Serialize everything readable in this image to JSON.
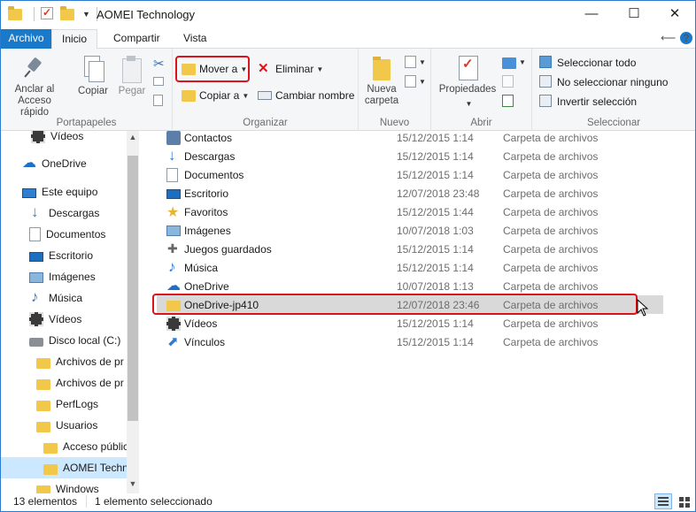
{
  "window": {
    "title": "AOMEI Technology",
    "minimize": "—",
    "maximize": "☐",
    "close": "✕"
  },
  "tabs": {
    "file": "Archivo",
    "home": "Inicio",
    "share": "Compartir",
    "view": "Vista",
    "help": "?"
  },
  "ribbon": {
    "clipboard": {
      "label": "Portapapeles",
      "pin": "Anclar al Acceso rápido",
      "copy": "Copiar",
      "paste": "Pegar"
    },
    "organize": {
      "label": "Organizar",
      "move_to": "Mover a",
      "copy_to": "Copiar a",
      "delete": "Eliminar",
      "rename": "Cambiar nombre"
    },
    "new": {
      "label": "Nuevo",
      "new_folder": "Nueva carpeta"
    },
    "open": {
      "label": "Abrir",
      "properties": "Propiedades"
    },
    "select": {
      "label": "Seleccionar",
      "select_all": "Seleccionar todo",
      "select_none": "No seleccionar ninguno",
      "invert": "Invertir selección"
    }
  },
  "nav": {
    "items": [
      {
        "label": "Vídeos",
        "icon": "video-icon"
      },
      {
        "label": "OneDrive",
        "icon": "onedrive-icon"
      },
      {
        "label": "Este equipo",
        "icon": "computer-icon"
      },
      {
        "label": "Descargas",
        "icon": "download-icon"
      },
      {
        "label": "Documentos",
        "icon": "documents-icon"
      },
      {
        "label": "Escritorio",
        "icon": "desktop-icon"
      },
      {
        "label": "Imágenes",
        "icon": "images-icon"
      },
      {
        "label": "Música",
        "icon": "music-icon"
      },
      {
        "label": "Vídeos",
        "icon": "video-icon"
      },
      {
        "label": "Disco local (C:)",
        "icon": "disk-icon"
      },
      {
        "label": "Archivos de pr",
        "icon": "folder-icon"
      },
      {
        "label": "Archivos de pr",
        "icon": "folder-icon"
      },
      {
        "label": "PerfLogs",
        "icon": "folder-icon"
      },
      {
        "label": "Usuarios",
        "icon": "folder-icon"
      },
      {
        "label": "Acceso públic",
        "icon": "folder-icon"
      },
      {
        "label": "AOMEI Techn",
        "icon": "folder-icon"
      },
      {
        "label": "Windows",
        "icon": "folder-icon"
      }
    ]
  },
  "files": [
    {
      "name": "Contactos",
      "date": "15/12/2015 1:14",
      "type": "Carpeta de archivos",
      "icon": "contacts-icon"
    },
    {
      "name": "Descargas",
      "date": "15/12/2015 1:14",
      "type": "Carpeta de archivos",
      "icon": "download-icon"
    },
    {
      "name": "Documentos",
      "date": "15/12/2015 1:14",
      "type": "Carpeta de archivos",
      "icon": "documents-icon"
    },
    {
      "name": "Escritorio",
      "date": "12/07/2018 23:48",
      "type": "Carpeta de archivos",
      "icon": "desktop-icon"
    },
    {
      "name": "Favoritos",
      "date": "15/12/2015 1:44",
      "type": "Carpeta de archivos",
      "icon": "star-icon"
    },
    {
      "name": "Imágenes",
      "date": "10/07/2018 1:03",
      "type": "Carpeta de archivos",
      "icon": "images-icon"
    },
    {
      "name": "Juegos guardados",
      "date": "15/12/2015 1:14",
      "type": "Carpeta de archivos",
      "icon": "games-icon"
    },
    {
      "name": "Música",
      "date": "15/12/2015 1:14",
      "type": "Carpeta de archivos",
      "icon": "music-icon"
    },
    {
      "name": "OneDrive",
      "date": "10/07/2018 1:13",
      "type": "Carpeta de archivos",
      "icon": "onedrive-icon"
    },
    {
      "name": "OneDrive-jp410",
      "date": "12/07/2018 23:46",
      "type": "Carpeta de archivos",
      "icon": "folder-icon"
    },
    {
      "name": "Vídeos",
      "date": "15/12/2015 1:14",
      "type": "Carpeta de archivos",
      "icon": "video-icon"
    },
    {
      "name": "Vínculos",
      "date": "15/12/2015 1:14",
      "type": "Carpeta de archivos",
      "icon": "link-icon"
    }
  ],
  "status": {
    "count": "13 elementos",
    "selected": "1 elemento seleccionado"
  },
  "colors": {
    "accent": "#1979ca",
    "highlight": "#d9141d",
    "selection": "#d9d9d9"
  }
}
